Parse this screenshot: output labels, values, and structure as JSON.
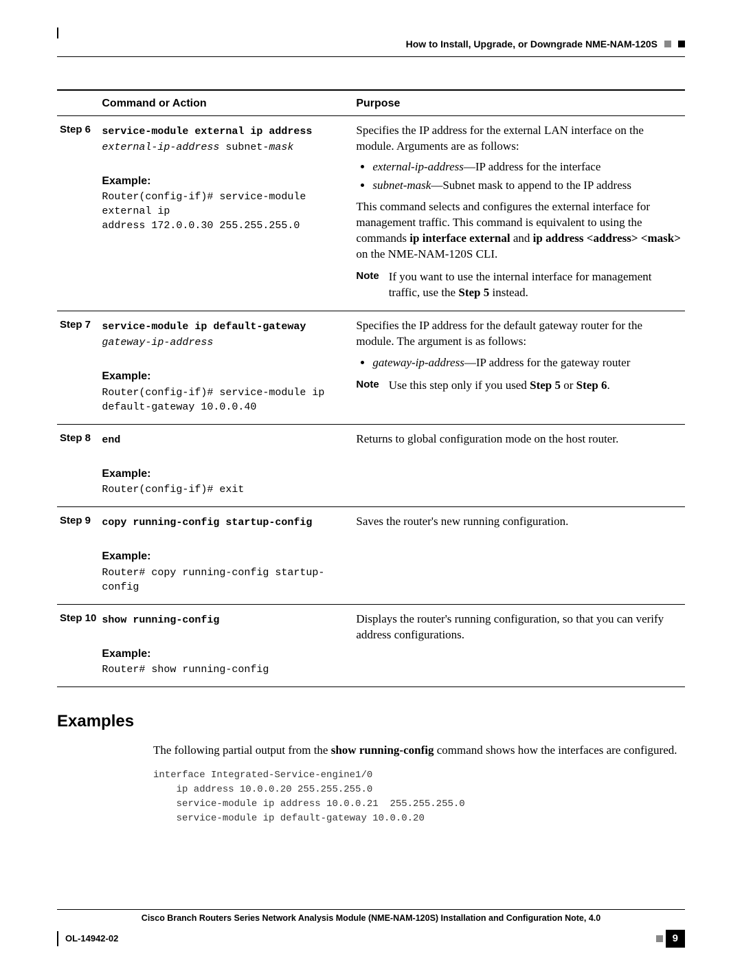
{
  "running_head": {
    "title": "How to Install, Upgrade, or Downgrade NME-NAM-120S"
  },
  "table": {
    "headers": {
      "col0": "",
      "col1": "Command or Action",
      "col2": "Purpose"
    },
    "rows": [
      {
        "step": "Step 6",
        "cmd_bold": "service-module external ip address",
        "cmd_italic": "external-ip-address ",
        "cmd_plain": "subnet-",
        "cmd_italic2": "mask",
        "example_label": "Example:",
        "example_text": "Router(config-if)# service-module external ip \naddress 172.0.0.30 255.255.255.0",
        "purpose_intro": "Specifies the IP address for the external LAN interface on the module. Arguments are as follows:",
        "bullets": [
          {
            "it": "external-ip-address",
            "rest": "—IP address for the interface"
          },
          {
            "it": "subnet-mask",
            "rest": "—Subnet mask to append to the IP address"
          }
        ],
        "purpose_para2_a": "This command selects and configures the external interface for management traffic. This command is equivalent to using the commands ",
        "purpose_para2_b1": "ip interface external",
        "purpose_para2_mid": " and ",
        "purpose_para2_b2": "ip address <address> <mask>",
        "purpose_para2_end": " on the NME-NAM-120S CLI.",
        "note_label": "Note",
        "note_text_a": "If you want to use the internal interface for management traffic, use the ",
        "note_text_b": "Step 5",
        "note_text_c": " instead."
      },
      {
        "step": "Step 7",
        "cmd_bold": "service-module ip default-gateway",
        "cmd_italic": "gateway-ip-address",
        "example_label": "Example:",
        "example_text": "Router(config-if)# service-module ip \ndefault-gateway 10.0.0.40",
        "purpose_intro": "Specifies the IP address for the default gateway router for the module. The argument is as follows:",
        "bullets": [
          {
            "it": "gateway-ip-address",
            "rest": "—IP address for the gateway router"
          }
        ],
        "note_label": "Note",
        "note_text_a": "Use this step only if you used ",
        "note_text_b": "Step 5",
        "note_text_mid": " or ",
        "note_text_b2": "Step 6",
        "note_text_c": "."
      },
      {
        "step": "Step 8",
        "cmd_bold": "end",
        "example_label": "Example:",
        "example_text": "Router(config-if)# exit",
        "purpose_intro": "Returns to global configuration mode on the host router."
      },
      {
        "step": "Step 9",
        "cmd_bold": "copy running-config startup-config",
        "example_label": "Example:",
        "example_text": "Router# copy running-config startup-config",
        "purpose_intro": "Saves the router's new running configuration."
      },
      {
        "step": "Step 10",
        "cmd_bold": "show running-config",
        "example_label": "Example:",
        "example_text": "Router# show running-config",
        "purpose_intro": "Displays the router's running configuration, so that you can verify address configurations."
      }
    ]
  },
  "examples": {
    "heading": "Examples",
    "para_a": "The following partial output from the ",
    "para_b": "show running-config",
    "para_c": " command shows how the interfaces are configured.",
    "code": "interface Integrated-Service-engine1/0\n    ip address 10.0.0.20 255.255.255.0\n    service-module ip address 10.0.0.21  255.255.255.0\n    service-module ip default-gateway 10.0.0.20"
  },
  "footer": {
    "title": "Cisco Branch Routers Series Network Analysis Module (NME-NAM-120S) Installation and Configuration Note, 4.0",
    "doc_id": "OL-14942-02",
    "page_no": "9"
  }
}
